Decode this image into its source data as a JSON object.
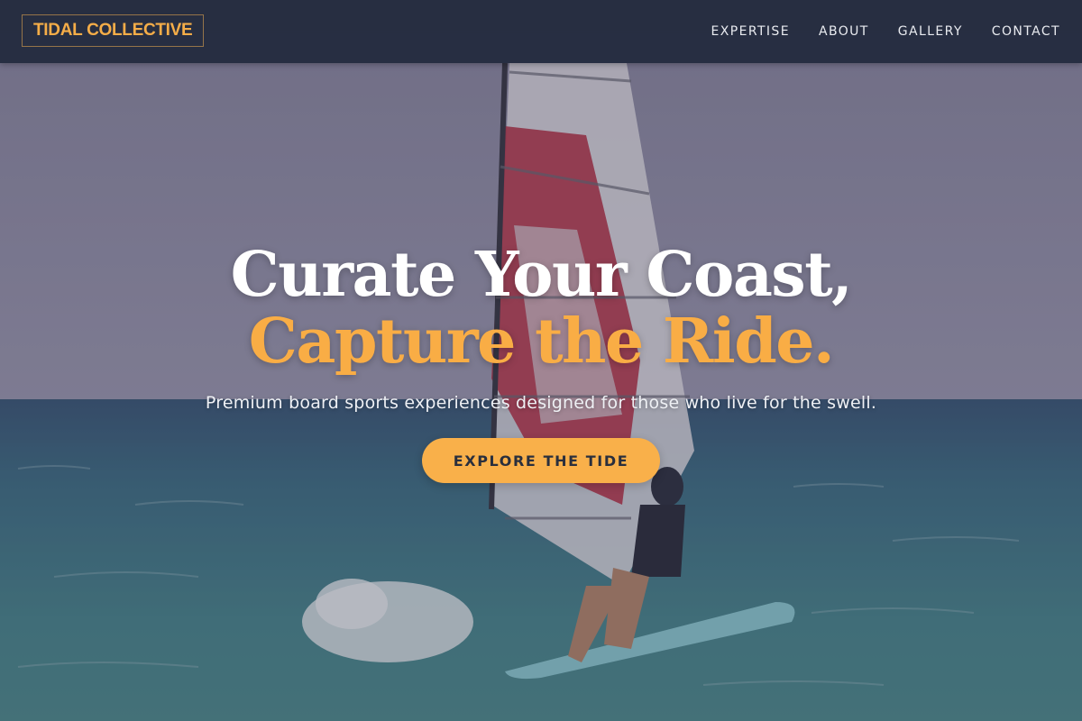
{
  "brand": {
    "name": "TIDAL COLLECTIVE"
  },
  "nav": {
    "items": [
      {
        "label": "EXPERTISE"
      },
      {
        "label": "ABOUT"
      },
      {
        "label": "GALLERY"
      },
      {
        "label": "CONTACT"
      }
    ]
  },
  "hero": {
    "headline_line1": "Curate Your Coast,",
    "headline_line2": "Capture the Ride.",
    "subtitle": "Premium board sports experiences designed for those who live for the swell.",
    "cta_label": "EXPLORE THE TIDE",
    "background_image": "windsurfer-on-ocean"
  },
  "colors": {
    "navbar_bg": "#21293c",
    "accent": "#f9ad45",
    "headline_white": "#ffffff",
    "nav_text": "#e9ebf0",
    "cta_text": "#2a2f3d"
  }
}
